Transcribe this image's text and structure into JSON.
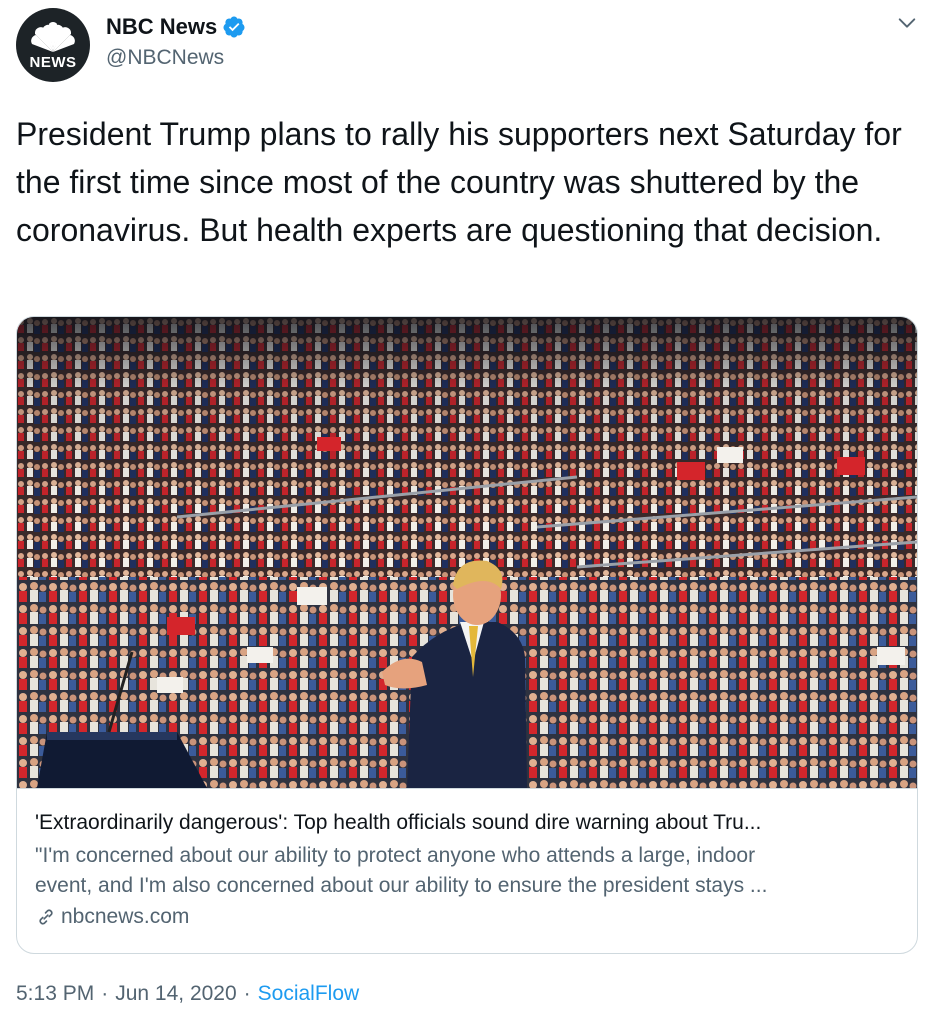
{
  "author": {
    "display_name": "NBC News",
    "handle": "@NBCNews",
    "avatar_text": "NEWS",
    "verified_icon": "verified-badge-icon"
  },
  "tweet": {
    "text": "President Trump plans to rally his supporters next Saturday for the first time since most of the country was shuttered by the coronavirus. But health experts are questioning that decision."
  },
  "card": {
    "image_description": "Trump at rally podium in front of packed arena crowd",
    "title": "'Extraordinarily dangerous': Top health officials sound dire warning about Tru...",
    "description_line1": "\"I'm concerned about our ability to protect anyone who attends a large, indoor",
    "description_line2": "event, and I'm also concerned about our ability to ensure the president stays ...",
    "domain": "nbcnews.com"
  },
  "meta": {
    "time": "5:13 PM",
    "date": "Jun 14, 2020",
    "separator": "·",
    "source": "SocialFlow"
  },
  "colors": {
    "accent": "#1d9bf0",
    "secondary_text": "#536471",
    "border": "#cfd9de"
  }
}
